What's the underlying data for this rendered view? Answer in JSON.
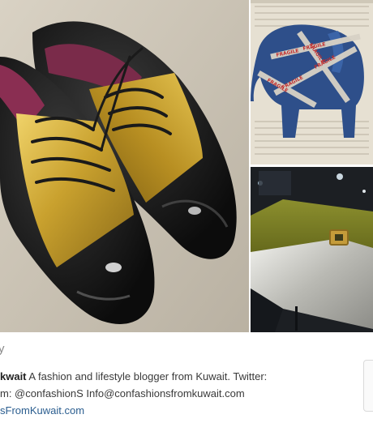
{
  "profile": {
    "handle_fragment": "y",
    "bio_name": "kwait",
    "bio_text": " A fashion and lifestyle blogger from Kuwait. Twitter:",
    "bio_line2": "m: @confashionS Info@confashionsfromkuwait.com",
    "website": "sFromKuwait.com"
  },
  "grid": {
    "tiles": [
      {
        "subject": "black-patent-shoes-with-gold-panels"
      },
      {
        "subject": "elephant-painting-with-fragile-tape",
        "tape_text": "FRAGILE"
      },
      {
        "subject": "olive-and-silver-clutch-bag"
      }
    ]
  },
  "colors": {
    "link": "#2a5d8f",
    "text": "#3a3a3a",
    "gold": "#c9a12e",
    "patent_black": "#141414"
  }
}
